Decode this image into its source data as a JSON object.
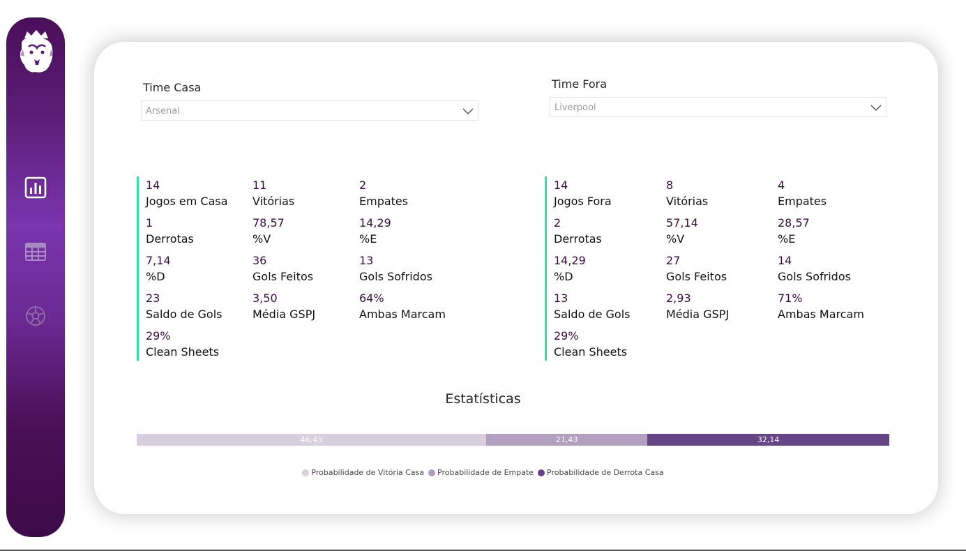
{
  "sidebar": {
    "icons": [
      "premier-league-lion-logo",
      "report-chart-icon",
      "table-grid-icon",
      "football-icon"
    ]
  },
  "home_selector": {
    "label": "Time Casa",
    "value": "Arsenal"
  },
  "away_selector": {
    "label": "Time Fora",
    "value": "Liverpool"
  },
  "home_stats": [
    {
      "value": "14",
      "label": "Jogos em Casa"
    },
    {
      "value": "11",
      "label": "Vitórias"
    },
    {
      "value": "2",
      "label": "Empates"
    },
    {
      "value": "1",
      "label": "Derrotas"
    },
    {
      "value": "78,57",
      "label": "%V"
    },
    {
      "value": "14,29",
      "label": "%E"
    },
    {
      "value": "7,14",
      "label": "%D"
    },
    {
      "value": "36",
      "label": "Gols Feitos"
    },
    {
      "value": "13",
      "label": "Gols Sofridos"
    },
    {
      "value": "23",
      "label": "Saldo de Gols"
    },
    {
      "value": "3,50",
      "label": "Média GSPJ"
    },
    {
      "value": "64%",
      "label": "Ambas Marcam"
    },
    {
      "value": "29%",
      "label": "Clean Sheets"
    }
  ],
  "away_stats": [
    {
      "value": "14",
      "label": "Jogos Fora"
    },
    {
      "value": "8",
      "label": "Vitórias"
    },
    {
      "value": "4",
      "label": "Empates"
    },
    {
      "value": "2",
      "label": "Derrotas"
    },
    {
      "value": "57,14",
      "label": "%V"
    },
    {
      "value": "28,57",
      "label": "%E"
    },
    {
      "value": "14,29",
      "label": "%D"
    },
    {
      "value": "27",
      "label": "Gols Feitos"
    },
    {
      "value": "14",
      "label": "Gols Sofridos"
    },
    {
      "value": "13",
      "label": "Saldo de Gols"
    },
    {
      "value": "2,93",
      "label": "Média GSPJ"
    },
    {
      "value": "71%",
      "label": "Ambas Marcam"
    },
    {
      "value": "29%",
      "label": "Clean Sheets"
    }
  ],
  "colors": {
    "accent_border": "#2ee59d",
    "value_text": "#3b0a45",
    "win": "#d8cfde",
    "draw": "#b29fc0",
    "loss": "#654585"
  },
  "chart_data": {
    "type": "bar",
    "orientation": "horizontal-stacked-100",
    "title": "Estatísticas",
    "series": [
      {
        "name": "Probabilidade de Vitória Casa",
        "values": [
          46.43
        ],
        "label": "46,43",
        "color": "#d8cfde"
      },
      {
        "name": "Probabilidade de Empate",
        "values": [
          21.43
        ],
        "label": "21,43",
        "color": "#b29fc0"
      },
      {
        "name": "Probabilidade de Derrota Casa",
        "values": [
          32.14
        ],
        "label": "32,14",
        "color": "#654585"
      }
    ],
    "legend_position": "bottom-center"
  }
}
